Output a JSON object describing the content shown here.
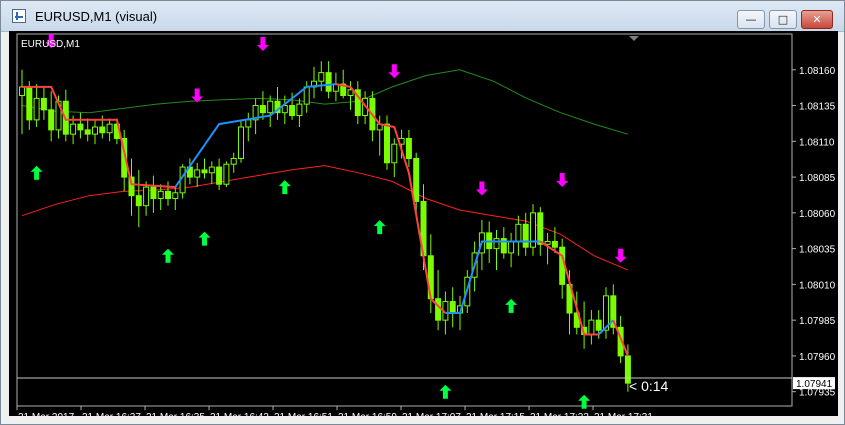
{
  "window": {
    "title": "EURUSD,M1 (visual)",
    "buttons": {
      "minimize": "—",
      "maximize": "□",
      "close": "✕"
    }
  },
  "chart_data": {
    "type": "candlestick",
    "symbol_label": "EURUSD,M1",
    "background": "#000000",
    "grid": false,
    "countdown": "< 0:14",
    "ylim": [
      1.07925,
      1.08185
    ],
    "y_ticks": [
      "1.08160",
      "1.08135",
      "1.08110",
      "1.08085",
      "1.08060",
      "1.08035",
      "1.08010",
      "1.07985",
      "1.07960",
      "1.07935"
    ],
    "current_price": "1.07941",
    "x_ticks": [
      "21 Mar 2017",
      "21 Mar 16:27",
      "21 Mar 16:35",
      "21 Mar 16:43",
      "21 Mar 16:51",
      "21 Mar 16:59",
      "21 Mar 17:07",
      "21 Mar 17:15",
      "21 Mar 17:23",
      "21 Mar 17:31"
    ],
    "colors": {
      "candle": "#7cfc00",
      "upper_band": "#228b22",
      "lower_band": "#ff2020",
      "trend_down": "#ff4040",
      "trend_up": "#1e90ff",
      "buy_arrow": "#00ff40",
      "sell_arrow": "#ff00ff",
      "axis_text": "#ffffff"
    },
    "candles": [
      [
        1.08142,
        1.0816,
        1.08115,
        1.08148
      ],
      [
        1.08148,
        1.08152,
        1.08118,
        1.08125
      ],
      [
        1.08125,
        1.0815,
        1.0812,
        1.0814
      ],
      [
        1.0814,
        1.08148,
        1.08125,
        1.08132
      ],
      [
        1.08132,
        1.08145,
        1.0811,
        1.08118
      ],
      [
        1.08118,
        1.08142,
        1.08112,
        1.08138
      ],
      [
        1.08138,
        1.08146,
        1.0811,
        1.08115
      ],
      [
        1.08115,
        1.08128,
        1.08108,
        1.08122
      ],
      [
        1.08122,
        1.0813,
        1.08112,
        1.08118
      ],
      [
        1.08118,
        1.08126,
        1.0811,
        1.08115
      ],
      [
        1.08115,
        1.08125,
        1.08108,
        1.0812
      ],
      [
        1.0812,
        1.08128,
        1.08112,
        1.08116
      ],
      [
        1.08116,
        1.08126,
        1.0811,
        1.08122
      ],
      [
        1.08122,
        1.08126,
        1.08108,
        1.08112
      ],
      [
        1.08112,
        1.08118,
        1.08075,
        1.08085
      ],
      [
        1.08085,
        1.08098,
        1.08058,
        1.08072
      ],
      [
        1.08072,
        1.0809,
        1.0805,
        1.08065
      ],
      [
        1.08065,
        1.08082,
        1.08058,
        1.08078
      ],
      [
        1.08078,
        1.08086,
        1.0806,
        1.0807
      ],
      [
        1.0807,
        1.0808,
        1.08062,
        1.08075
      ],
      [
        1.08075,
        1.08082,
        1.08065,
        1.0807
      ],
      [
        1.0807,
        1.08078,
        1.08062,
        1.08074
      ],
      [
        1.08074,
        1.08094,
        1.0807,
        1.08092
      ],
      [
        1.08092,
        1.08098,
        1.0808,
        1.08085
      ],
      [
        1.08085,
        1.08095,
        1.08078,
        1.0809
      ],
      [
        1.0809,
        1.08098,
        1.08084,
        1.08088
      ],
      [
        1.08088,
        1.08096,
        1.0808,
        1.08092
      ],
      [
        1.08092,
        1.08098,
        1.08076,
        1.0808
      ],
      [
        1.0808,
        1.08096,
        1.08078,
        1.08094
      ],
      [
        1.08094,
        1.08102,
        1.08088,
        1.08098
      ],
      [
        1.08098,
        1.08125,
        1.08095,
        1.0812
      ],
      [
        1.0812,
        1.0813,
        1.0811,
        1.08125
      ],
      [
        1.08125,
        1.0814,
        1.08115,
        1.08135
      ],
      [
        1.08135,
        1.08145,
        1.08125,
        1.0813
      ],
      [
        1.0813,
        1.08142,
        1.0812,
        1.08138
      ],
      [
        1.08138,
        1.08148,
        1.08125,
        1.0813
      ],
      [
        1.0813,
        1.08142,
        1.08122,
        1.08135
      ],
      [
        1.08135,
        1.08144,
        1.08125,
        1.08128
      ],
      [
        1.08128,
        1.0814,
        1.0812,
        1.08136
      ],
      [
        1.08136,
        1.08152,
        1.0813,
        1.08148
      ],
      [
        1.08148,
        1.08162,
        1.0814,
        1.08152
      ],
      [
        1.08152,
        1.08166,
        1.08145,
        1.08158
      ],
      [
        1.08158,
        1.08166,
        1.0814,
        1.08145
      ],
      [
        1.08145,
        1.08158,
        1.08138,
        1.0815
      ],
      [
        1.0815,
        1.0816,
        1.0814,
        1.08142
      ],
      [
        1.08142,
        1.08152,
        1.08132,
        1.08146
      ],
      [
        1.08146,
        1.08152,
        1.08122,
        1.08128
      ],
      [
        1.08128,
        1.08145,
        1.08122,
        1.0814
      ],
      [
        1.0814,
        1.08145,
        1.0811,
        1.08118
      ],
      [
        1.08118,
        1.08128,
        1.081,
        1.08122
      ],
      [
        1.08122,
        1.08128,
        1.0809,
        1.08095
      ],
      [
        1.08095,
        1.08112,
        1.08085,
        1.08108
      ],
      [
        1.08108,
        1.08118,
        1.08098,
        1.08112
      ],
      [
        1.08112,
        1.08118,
        1.08092,
        1.08098
      ],
      [
        1.08098,
        1.08102,
        1.0806,
        1.08068
      ],
      [
        1.08068,
        1.0808,
        1.0802,
        1.0803
      ],
      [
        1.0803,
        1.08045,
        1.0799,
        1.08
      ],
      [
        1.08,
        1.0802,
        1.07978,
        1.07985
      ],
      [
        1.07985,
        1.08005,
        1.07975,
        1.07998
      ],
      [
        1.07998,
        1.08008,
        1.0798,
        1.0799
      ],
      [
        1.0799,
        1.08002,
        1.07978,
        1.07995
      ],
      [
        1.07995,
        1.0802,
        1.0799,
        1.08015
      ],
      [
        1.08015,
        1.0804,
        1.08005,
        1.08032
      ],
      [
        1.08032,
        1.08055,
        1.0802,
        1.08046
      ],
      [
        1.08046,
        1.08054,
        1.08025,
        1.08035
      ],
      [
        1.08035,
        1.08048,
        1.0802,
        1.08042
      ],
      [
        1.08042,
        1.0805,
        1.08028,
        1.08032
      ],
      [
        1.08032,
        1.08046,
        1.08022,
        1.0804
      ],
      [
        1.0804,
        1.08058,
        1.0803,
        1.08052
      ],
      [
        1.08052,
        1.0806,
        1.0803,
        1.08036
      ],
      [
        1.08036,
        1.08066,
        1.0803,
        1.0806
      ],
      [
        1.0806,
        1.08064,
        1.0803,
        1.08038
      ],
      [
        1.08038,
        1.08046,
        1.08024,
        1.0804
      ],
      [
        1.0804,
        1.0805,
        1.08032,
        1.08036
      ],
      [
        1.08036,
        1.08042,
        1.08,
        1.0801
      ],
      [
        1.0801,
        1.0802,
        1.07975,
        1.0799
      ],
      [
        1.0799,
        1.08005,
        1.07975,
        1.0798
      ],
      [
        1.0798,
        1.07998,
        1.07965,
        1.07975
      ],
      [
        1.07975,
        1.07992,
        1.07968,
        1.07985
      ],
      [
        1.07985,
        1.07992,
        1.07972,
        1.07978
      ],
      [
        1.07978,
        1.08008,
        1.07972,
        1.08002
      ],
      [
        1.08002,
        1.0801,
        1.07975,
        1.0798
      ],
      [
        1.0798,
        1.07988,
        1.07955,
        1.0796
      ],
      [
        1.0796,
        1.07968,
        1.07935,
        1.07941
      ]
    ],
    "upper_band": [
      1.08135,
      1.08131,
      1.0813,
      1.08133,
      1.08136,
      1.08138,
      1.08139,
      1.0814,
      1.08139,
      1.08136,
      1.08138,
      1.08148,
      1.08156,
      1.0816,
      1.08152,
      1.0814,
      1.0813,
      1.08122,
      1.08115
    ],
    "lower_band": [
      1.08058,
      1.08066,
      1.08072,
      1.08075,
      1.08076,
      1.08078,
      1.08082,
      1.08086,
      1.0809,
      1.08093,
      1.08088,
      1.08082,
      1.0807,
      1.08062,
      1.08058,
      1.08054,
      1.08045,
      1.0803,
      1.0802
    ],
    "trend_segments": [
      {
        "dir": "down",
        "points": [
          [
            0,
            1.08148
          ],
          [
            4,
            1.08148
          ],
          [
            6,
            1.08125
          ],
          [
            13,
            1.08125
          ],
          [
            15,
            1.0808
          ],
          [
            21,
            1.08078
          ]
        ]
      },
      {
        "dir": "up",
        "points": [
          [
            21,
            1.08078
          ],
          [
            27,
            1.08122
          ],
          [
            34,
            1.08128
          ],
          [
            39,
            1.08148
          ],
          [
            43,
            1.0815
          ]
        ]
      },
      {
        "dir": "down",
        "points": [
          [
            43,
            1.0815
          ],
          [
            45,
            1.08148
          ],
          [
            49,
            1.08122
          ],
          [
            51,
            1.0812
          ],
          [
            53,
            1.08088
          ],
          [
            56,
            1.08
          ],
          [
            58,
            1.0799
          ]
        ]
      },
      {
        "dir": "up",
        "points": [
          [
            58,
            1.0799
          ],
          [
            60,
            1.0799
          ],
          [
            63,
            1.0804
          ],
          [
            71,
            1.0804
          ]
        ]
      },
      {
        "dir": "down",
        "points": [
          [
            71,
            1.0804
          ],
          [
            74,
            1.0803
          ],
          [
            77,
            1.07975
          ],
          [
            79,
            1.07975
          ]
        ]
      },
      {
        "dir": "up",
        "points": [
          [
            79,
            1.07975
          ],
          [
            81,
            1.07985
          ]
        ]
      },
      {
        "dir": "down",
        "points": [
          [
            81,
            1.07985
          ],
          [
            83,
            1.0796
          ]
        ]
      }
    ],
    "buy_arrows": [
      [
        2,
        1.08088
      ],
      [
        20,
        1.0803
      ],
      [
        25,
        1.08042
      ],
      [
        36,
        1.08078
      ],
      [
        49,
        1.0805
      ],
      [
        58,
        1.07935
      ],
      [
        67,
        1.07995
      ],
      [
        77,
        1.07928
      ]
    ],
    "sell_arrows": [
      [
        4,
        1.0818
      ],
      [
        24,
        1.08142
      ],
      [
        33,
        1.08178
      ],
      [
        51,
        1.08159
      ],
      [
        63,
        1.08077
      ],
      [
        74,
        1.08083
      ],
      [
        82,
        1.0803
      ]
    ]
  }
}
